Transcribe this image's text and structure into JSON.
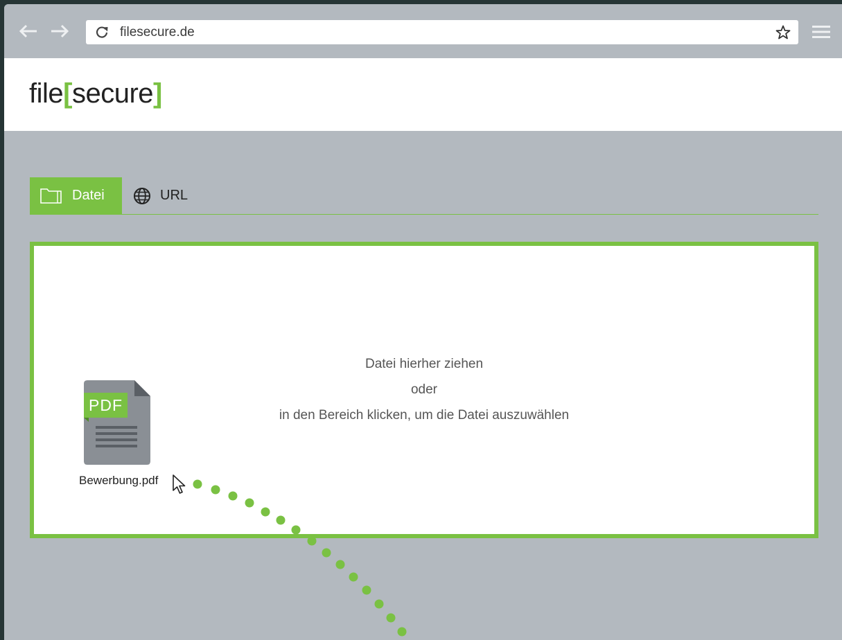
{
  "browser": {
    "url": "filesecure.de",
    "icons": {
      "back": "arrow-left-icon",
      "forward": "arrow-right-icon",
      "reload": "reload-icon",
      "bookmark": "star-icon",
      "menu": "hamburger-menu-icon"
    }
  },
  "header": {
    "logo": {
      "prefix": "file",
      "open_bracket": "[",
      "word": "secure",
      "close_bracket": "]"
    }
  },
  "tabs": [
    {
      "label": "Datei",
      "icon": "folder-icon",
      "active": true
    },
    {
      "label": "URL",
      "icon": "globe-icon",
      "active": false
    }
  ],
  "drop_zone": {
    "line1": "Datei hierher ziehen",
    "line2": "oder",
    "line3": "in den Bereich klicken, um die Datei auszuwählen"
  },
  "dragged_file": {
    "type_label": "PDF",
    "name": "Bewerbung.pdf",
    "icon": "pdf-file-icon"
  },
  "colors": {
    "accent": "#7ac143",
    "page_background": "#b3b9bf",
    "frame": "#263535"
  }
}
